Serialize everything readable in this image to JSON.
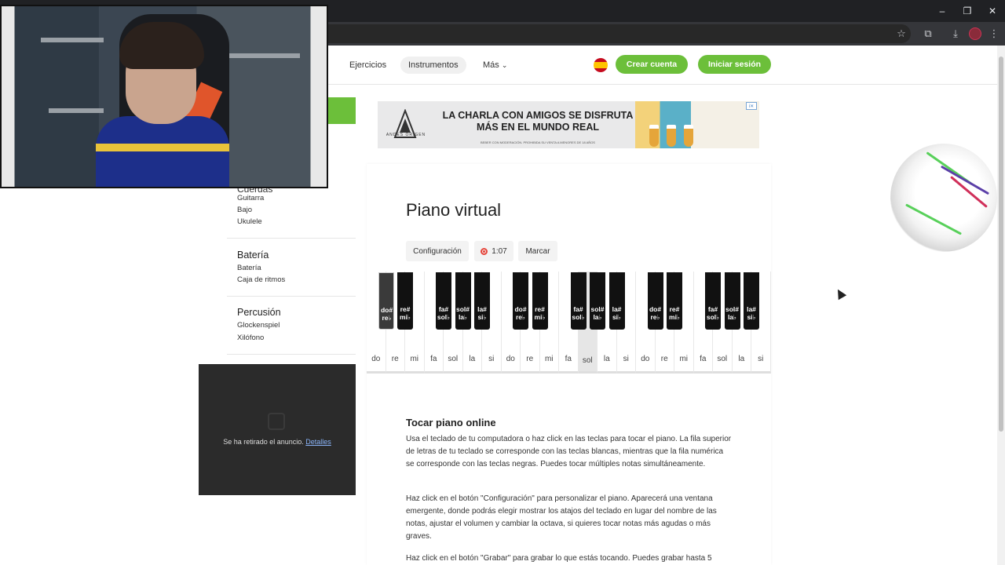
{
  "browser": {
    "window_controls": {
      "minimize": "–",
      "maximize": "❐",
      "close": "✕"
    }
  },
  "header": {
    "nav": [
      "Ejercicios",
      "Instrumentos",
      "Más"
    ],
    "more_chevron": "⌄",
    "create_account": "Crear cuenta",
    "login": "Iniciar sesión"
  },
  "sidebar": {
    "partial_heading": "Cuerdas",
    "strings_items": [
      "Guitarra",
      "Bajo",
      "Ukulele"
    ],
    "drums": {
      "title": "Batería",
      "items": [
        "Batería",
        "Caja de ritmos"
      ]
    },
    "percussion": {
      "title": "Percusión",
      "items": [
        "Glockenspiel",
        "Xilófono"
      ]
    },
    "ad_removed": {
      "text": "Se ha retirado el anuncio.",
      "link": "Detalles"
    }
  },
  "ad": {
    "headline": "LA CHARLA CON AMIGOS SE DISFRUTA MÁS EN EL MUNDO REAL",
    "brand": "ANDES ORIGEN",
    "fineprint": "BEBER CON MODERACIÓN. PROHIBIDA SU VENTA A MENORES DE 18 AÑOS",
    "info_badge": "i✕"
  },
  "main": {
    "title": "Piano virtual",
    "controls": {
      "config": "Configuración",
      "timer": "1:07",
      "mark": "Marcar"
    },
    "piano": {
      "white_keys": [
        "do",
        "re",
        "mi",
        "fa",
        "sol",
        "la",
        "si",
        "do",
        "re",
        "mi",
        "fa",
        "sol",
        "la",
        "si",
        "do",
        "re",
        "mi",
        "fa",
        "sol",
        "la",
        "si"
      ],
      "pressed_white_index": 11,
      "black_keys": [
        "do#\nre♭",
        "re#\nmi♭",
        "fa#\nsol♭",
        "sol#\nla♭",
        "la#\nsi♭",
        "do#\nre♭",
        "re#\nmi♭",
        "fa#\nsol♭",
        "sol#\nla♭",
        "la#\nsi♭",
        "do#\nre♭",
        "re#\nmi♭",
        "fa#\nsol♭",
        "sol#\nla♭",
        "la#\nsi♭"
      ],
      "pressed_black_index": 0
    },
    "article": {
      "title": "Tocar piano online",
      "p1": "Usa el teclado de tu computadora o haz click en las teclas para tocar el piano. La fila superior de letras de tu teclado se corresponde con las teclas blancas, mientras que la fila numérica se corresponde con las teclas negras. Puedes tocar múltiples notas simultáneamente.",
      "p2": "Haz click en el botón \"Configuración\" para personalizar el piano. Aparecerá una ventana emergente, donde podrás elegir mostrar los atajos del teclado en lugar del nombre de las notas, ajustar el volumen y cambiar la octava, si quieres tocar notas más agudas o más graves.",
      "p3": "Haz click en el botón \"Grabar\" para grabar lo que estás tocando. Puedes grabar hasta 5"
    }
  },
  "colors": {
    "accent_green": "#6cbf3a",
    "record_red": "#e6453b"
  }
}
